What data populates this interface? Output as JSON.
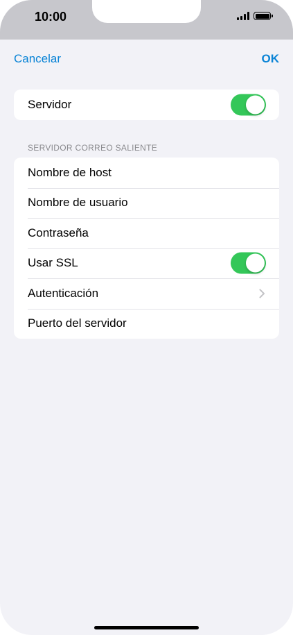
{
  "status": {
    "time": "10:00",
    "signal_icon": "cellular-signal-icon",
    "battery_icon": "battery-icon"
  },
  "nav": {
    "cancel_label": "Cancelar",
    "ok_label": "OK"
  },
  "server": {
    "label": "Servidor",
    "enabled": true
  },
  "outgoing": {
    "section_header": "SERVIDOR CORREO SALIENTE",
    "rows": [
      {
        "label": "Nombre de host"
      },
      {
        "label": "Nombre de usuario"
      },
      {
        "label": "Contraseña"
      },
      {
        "label": "Usar SSL",
        "toggle": true
      },
      {
        "label": "Autenticación",
        "icon": "chevron-right-icon"
      },
      {
        "label": "Puerto del servidor"
      }
    ]
  },
  "colors": {
    "accent": "#0a84d6",
    "toggle_on": "#34c759",
    "background": "#f2f2f7"
  }
}
